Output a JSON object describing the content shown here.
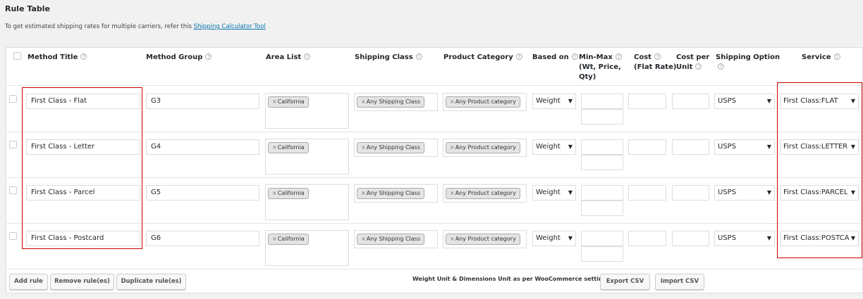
{
  "title": "Rule Table",
  "intro": {
    "text": "To get estimated shipping rates for multiple carriers, refer this ",
    "link": "Shipping Calculator Tool"
  },
  "headers": {
    "method_title": "Method Title",
    "method_group": "Method Group",
    "area_list": "Area List",
    "shipping_class": "Shipping Class",
    "product_category": "Product Category",
    "based_on": "Based on",
    "min_max_1": "Min-Max",
    "min_max_2": "(Wt, Price,",
    "min_max_3": "Qty)",
    "cost_1": "Cost",
    "cost_2": "(Flat Rate)",
    "cost_per_unit_1": "Cost per",
    "cost_per_unit_2": "Unit",
    "shipping_option": "Shipping Option",
    "service": "Service"
  },
  "help_icon": "?",
  "rows": [
    {
      "title": "First Class - Flat",
      "group": "G3",
      "area": "California",
      "shipping_class": "Any Shipping Class",
      "product_category": "Any Product category",
      "based_on": "Weight",
      "shipping_option": "USPS",
      "service": "First Class:FLAT"
    },
    {
      "title": "First Class - Letter",
      "group": "G4",
      "area": "California",
      "shipping_class": "Any Shipping Class",
      "product_category": "Any Product category",
      "based_on": "Weight",
      "shipping_option": "USPS",
      "service": "First Class:LETTER"
    },
    {
      "title": "First Class - Parcel",
      "group": "G5",
      "area": "California",
      "shipping_class": "Any Shipping Class",
      "product_category": "Any Product category",
      "based_on": "Weight",
      "shipping_option": "USPS",
      "service": "First Class:PARCEL"
    },
    {
      "title": "First Class - Postcard",
      "group": "G6",
      "area": "California",
      "shipping_class": "Any Shipping Class",
      "product_category": "Any Product category",
      "based_on": "Weight",
      "shipping_option": "USPS",
      "service": "First Class:POSTCA"
    }
  ],
  "chip_remove": "×",
  "dropdown_arrow": "▼",
  "buttons": {
    "add_rule": "Add rule",
    "remove_rules": "Remove rule(es)",
    "duplicate_rules": "Duplicate rule(es)",
    "export_csv": "Export CSV",
    "import_csv": "Import CSV"
  },
  "footer_note": "Weight Unit & Dimensions Unit as per WooCommerce settings.",
  "colors": {
    "accent": "#0073aa",
    "highlight": "#cc0000"
  }
}
